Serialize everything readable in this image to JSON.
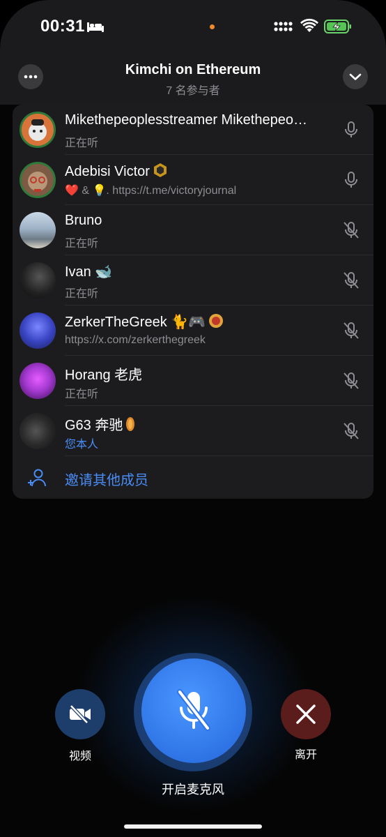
{
  "status_bar": {
    "time": "00:31"
  },
  "header": {
    "title": "Kimchi on Ethereum",
    "subtitle": "7 名参与者"
  },
  "participants": [
    {
      "name": "Mikethepeoplesstreamer Mikethepeo…",
      "status": "正在听",
      "status_color": "gray",
      "mic": "mic-on-icon",
      "ring": true,
      "avatar_color": "#d8743a"
    },
    {
      "name": "Adebisi Victor",
      "status": "❤️ & 💡. https://t.me/victoryjournal",
      "status_color": "gray",
      "mic": "mic-on-icon",
      "ring": true,
      "avatar_color": "#7d5a44"
    },
    {
      "name": "Bruno",
      "status": "正在听",
      "status_color": "gray",
      "mic": "mic-off-icon",
      "ring": false,
      "avatar_color": "#9fb3c8"
    },
    {
      "name": "Ivan 🐋",
      "status": "正在听",
      "status_color": "gray",
      "mic": "mic-off-icon",
      "ring": false,
      "avatar_color": "#2a2a2a"
    },
    {
      "name": "ZerkerTheGreek 🐈🎮",
      "status": "https://x.com/zerkerthegreek",
      "status_color": "gray",
      "mic": "mic-off-icon",
      "ring": false,
      "avatar_color": "#3a46c4"
    },
    {
      "name": "Horang 老虎",
      "status": "正在听",
      "status_color": "gray",
      "mic": "mic-off-icon",
      "ring": false,
      "avatar_color": "#a53ad1"
    },
    {
      "name": "G63 奔驰",
      "status": "您本人",
      "status_color": "blue",
      "mic": "mic-off-icon",
      "ring": false,
      "avatar_color": "#333333"
    }
  ],
  "invite": {
    "label": "邀请其他成员"
  },
  "controls": {
    "video_label": "视频",
    "mic_label": "开启麦克风",
    "leave_label": "离开"
  },
  "colors": {
    "accent_blue": "#4a8cf5",
    "panel_bg": "#1c1c1e",
    "leave_bg": "#5a1d1b"
  }
}
